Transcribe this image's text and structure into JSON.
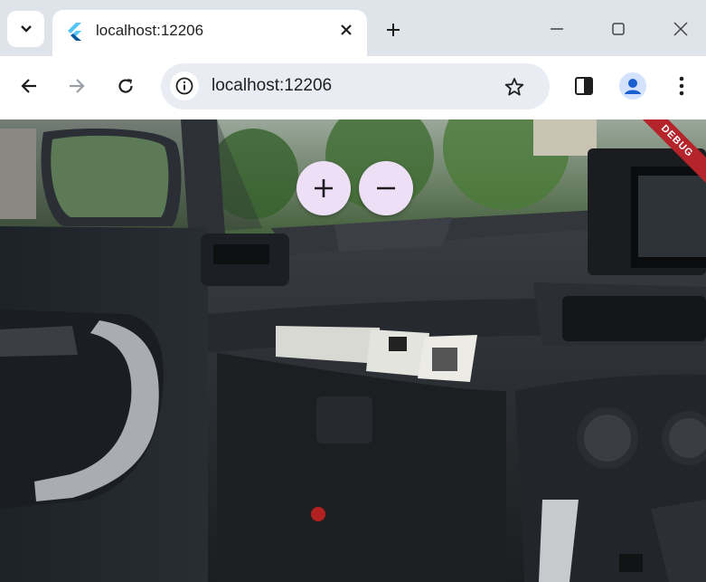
{
  "browser": {
    "tab": {
      "title": "localhost:12206"
    },
    "address_bar": {
      "url": "localhost:12206"
    }
  },
  "app": {
    "zoom_in_icon": "plus-icon",
    "zoom_out_icon": "minus-icon",
    "debug_banner": "DEBUG"
  },
  "colors": {
    "tab_strip": "#dfe3ea",
    "zoom_button_bg": "#ecdff6",
    "debug_banner": "#b5232b",
    "profile": "#1a5fd1"
  }
}
